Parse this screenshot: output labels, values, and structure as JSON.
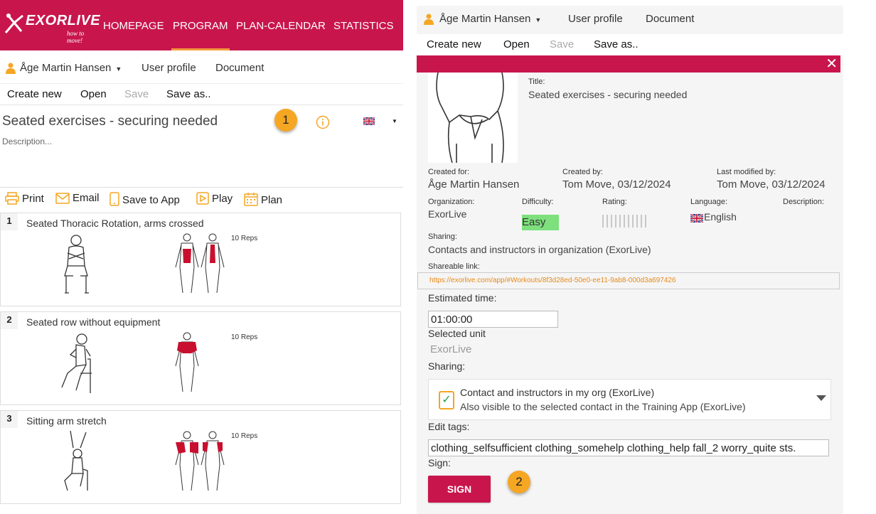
{
  "nav": {
    "logo_text": "EXORLIVE",
    "logo_sub": "how to move!",
    "items": [
      "HOMEPAGE",
      "PROGRAM",
      "PLAN-CALENDAR",
      "STATISTICS"
    ],
    "active": "PROGRAM"
  },
  "user": {
    "name": "Åge Martin Hansen",
    "profile": "User profile",
    "document": "Document"
  },
  "filemenu": {
    "create_new": "Create new",
    "open": "Open",
    "save": "Save",
    "save_as": "Save as.."
  },
  "workout": {
    "title": "Seated exercises - securing needed",
    "description_placeholder": "Description..."
  },
  "actions": {
    "print": "Print",
    "email": "Email",
    "save_to_app": "Save to App",
    "play": "Play",
    "plan": "Plan"
  },
  "badges": {
    "one": "1",
    "two": "2"
  },
  "exercises": [
    {
      "num": "1",
      "name": "Seated Thoracic Rotation, arms crossed",
      "reps": "10 Reps"
    },
    {
      "num": "2",
      "name": "Seated row without equipment",
      "reps": "10 Reps"
    },
    {
      "num": "3",
      "name": "Sitting arm stretch",
      "reps": "10 Reps"
    }
  ],
  "details": {
    "title_label": "Title:",
    "title_value": "Seated exercises - securing needed",
    "created_for_label": "Created for:",
    "created_for_value": "Åge Martin Hansen",
    "created_by_label": "Created by:",
    "created_by_value": "Tom Move, 03/12/2024",
    "last_modified_label": "Last modified by:",
    "last_modified_value": "Tom Move, 03/12/2024",
    "organization_label": "Organization:",
    "organization_value": "ExorLive",
    "difficulty_label": "Difficulty:",
    "difficulty_value": "Easy",
    "rating_label": "Rating:",
    "language_label": "Language:",
    "language_value": "English",
    "description_label": "Description:",
    "sharing_label": "Sharing:",
    "sharing_value": "Contacts and instructors in organization (ExorLive)",
    "shareable_link_label": "Shareable link:",
    "shareable_link": "https://exorlive.com/app/#Workouts/8f3d28ed-50e0-ee11-9ab8-000d3a697426",
    "estimated_time_label": "Estimated time:",
    "estimated_time_value": "01:00:00",
    "selected_unit_label": "Selected unit",
    "selected_unit_value": "ExorLive",
    "sharing_edit_label": "Sharing:",
    "sharing_option_title": "Contact and instructors in my org (ExorLive)",
    "sharing_option_sub": "Also visible to the selected contact in the Training App (ExorLive)",
    "edit_tags_label": "Edit tags:",
    "tags_value": "clothing_selfsufficient clothing_somehelp clothing_help fall_2 worry_quite sts.",
    "sign_label": "Sign:",
    "sign_button": "SIGN"
  },
  "colors": {
    "brand": "#c8164d",
    "accent": "#f5a623",
    "easy": "#7de07d",
    "link": "#e78a1a"
  }
}
